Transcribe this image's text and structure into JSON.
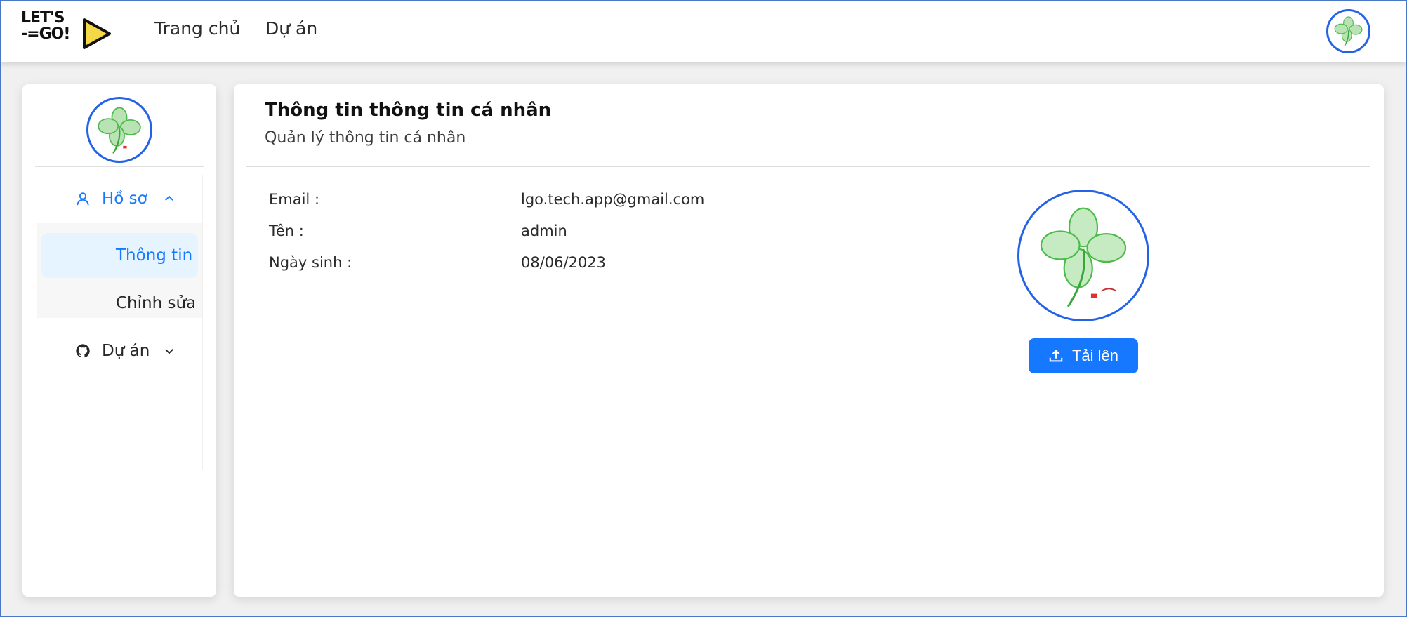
{
  "header": {
    "logo": {
      "line1": "LET'S",
      "line2": "-=GO!"
    },
    "nav": [
      {
        "label": "Trang chủ"
      },
      {
        "label": "Dự án"
      }
    ]
  },
  "sidebar": {
    "menu": {
      "profile": {
        "label": "Hồ sơ",
        "icon": "user-icon",
        "expanded": true
      },
      "profile_items": [
        {
          "label": "Thông tin",
          "selected": true
        },
        {
          "label": "Chỉnh sửa",
          "selected": false
        }
      ],
      "projects": {
        "label": "Dự án",
        "icon": "github-icon",
        "expanded": false
      }
    }
  },
  "main": {
    "title": "Thông tin thông tin cá nhân",
    "subtitle": "Quản lý thông tin cá nhân",
    "fields": [
      {
        "label": "Email :",
        "value": "lgo.tech.app@gmail.com"
      },
      {
        "label": "Tên :",
        "value": "admin"
      },
      {
        "label": "Ngày sinh :",
        "value": "08/06/2023"
      }
    ],
    "upload_label": "Tải lên"
  },
  "colors": {
    "primary": "#1677ff",
    "avatar_border": "#2463e6",
    "selected_bg": "#e6f4ff",
    "logo_play": "#f5d845"
  }
}
